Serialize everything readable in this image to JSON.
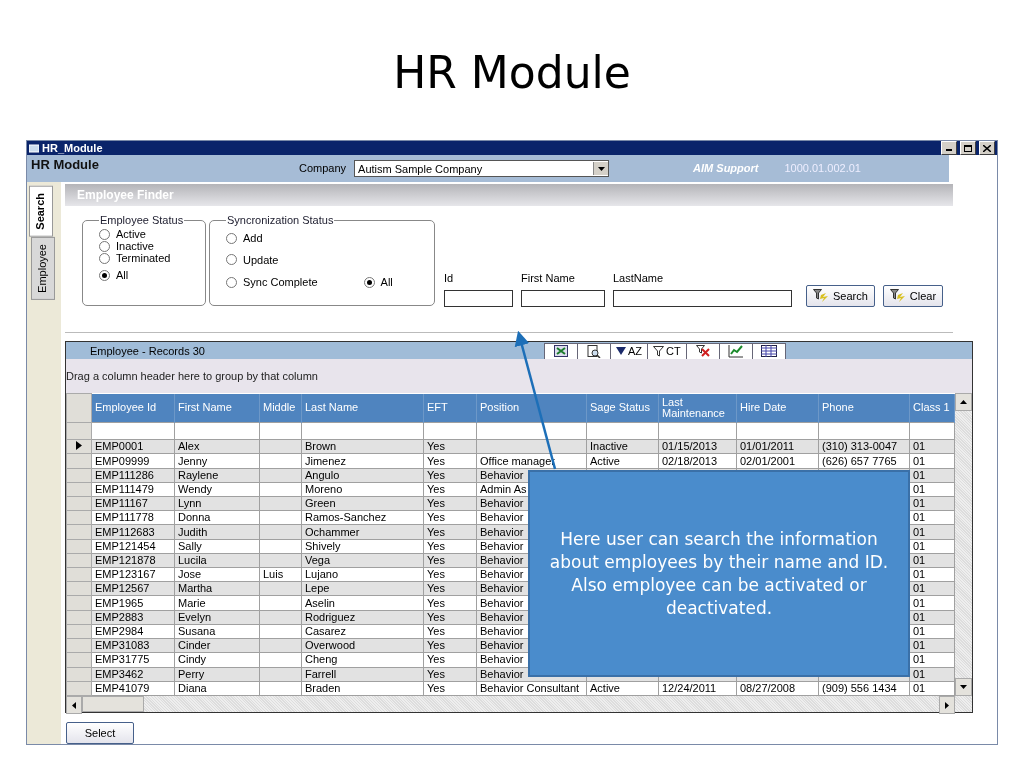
{
  "slide_title": "HR Module",
  "window": {
    "title": "HR_Module",
    "header": "HR Module",
    "company_label": "Company",
    "company_value": "Autism Sample Company",
    "brand": "AIM Support",
    "version": "1000.01.002.01"
  },
  "side_tabs": [
    {
      "label": "Search",
      "selected": true
    },
    {
      "label": "Employee",
      "selected": false
    }
  ],
  "finder": {
    "title": "Employee Finder",
    "employee_status": {
      "legend": "Employee Status",
      "options": [
        {
          "label": "Active",
          "selected": false
        },
        {
          "label": "Inactive",
          "selected": false
        },
        {
          "label": "Terminated",
          "selected": false
        },
        {
          "label": "All",
          "selected": true
        }
      ]
    },
    "sync_status": {
      "legend": "Syncronization Status",
      "options": [
        {
          "label": "Add",
          "selected": false
        },
        {
          "label": "Update",
          "selected": false
        },
        {
          "label": "Sync Complete",
          "selected": false
        },
        {
          "label": "All",
          "selected": true
        }
      ]
    },
    "fields": [
      {
        "label": "Id"
      },
      {
        "label": "First Name"
      },
      {
        "label": "LastName"
      }
    ],
    "buttons": [
      "Search",
      "Clear"
    ]
  },
  "grid": {
    "title": "Employee - Records 30",
    "group_hint": "Drag a column header here to group by that column",
    "toolbar": [
      {
        "kind": "export"
      },
      {
        "kind": "preview"
      },
      {
        "kind": "sort",
        "label": "AZ"
      },
      {
        "kind": "filter",
        "label": "CT"
      },
      {
        "kind": "clear"
      },
      {
        "kind": "chart"
      },
      {
        "kind": "columns"
      }
    ],
    "columns": [
      "Employee Id",
      "First Name",
      "Middle",
      "Last Name",
      "EFT",
      "Position",
      "Sage Status",
      "Last Maintenance",
      "Hire Date",
      "Phone",
      "Class 1"
    ],
    "rows": [
      {
        "selected": true,
        "cells": [
          "EMP0001",
          "Alex",
          null,
          "Brown",
          "Yes",
          null,
          "Inactive",
          "01/15/2013",
          "01/01/2011",
          "(310) 313-0047",
          "01"
        ]
      },
      {
        "selected": false,
        "cells": [
          "EMP09999",
          "Jenny",
          null,
          "Jimenez",
          "Yes",
          "Office manager",
          "Active",
          "02/18/2013",
          "02/01/2001",
          "(626) 657 7765",
          "01"
        ]
      },
      {
        "selected": false,
        "cells": [
          "EMP111286",
          "Raylene",
          null,
          "Angulo",
          "Yes",
          "Behavior",
          null,
          null,
          null,
          null,
          "01"
        ]
      },
      {
        "selected": false,
        "cells": [
          "EMP111479",
          "Wendy",
          null,
          "Moreno",
          "Yes",
          "Admin As",
          null,
          null,
          null,
          null,
          "01"
        ]
      },
      {
        "selected": false,
        "cells": [
          "EMP11167",
          "Lynn",
          null,
          "Green",
          "Yes",
          "Behavior",
          null,
          null,
          null,
          null,
          "01"
        ]
      },
      {
        "selected": false,
        "cells": [
          "EMP111778",
          "Donna",
          null,
          "Ramos-Sanchez",
          "Yes",
          "Behavior",
          null,
          null,
          null,
          null,
          "01"
        ]
      },
      {
        "selected": false,
        "cells": [
          "EMP112683",
          "Judith",
          null,
          "Ochammer",
          "Yes",
          "Behavior",
          null,
          null,
          null,
          null,
          "01"
        ]
      },
      {
        "selected": false,
        "cells": [
          "EMP121454",
          "Sally",
          null,
          "Shively",
          "Yes",
          "Behavior",
          null,
          null,
          null,
          null,
          "01"
        ]
      },
      {
        "selected": false,
        "cells": [
          "EMP121878",
          "Lucila",
          null,
          "Vega",
          "Yes",
          "Behavior",
          null,
          null,
          null,
          null,
          "01"
        ]
      },
      {
        "selected": false,
        "cells": [
          "EMP123167",
          "Jose",
          "Luis",
          "Lujano",
          "Yes",
          "Behavior",
          null,
          null,
          null,
          null,
          "01"
        ]
      },
      {
        "selected": false,
        "cells": [
          "EMP12567",
          "Martha",
          null,
          "Lepe",
          "Yes",
          "Behavior",
          null,
          null,
          null,
          null,
          "01"
        ]
      },
      {
        "selected": false,
        "cells": [
          "EMP1965",
          "Marie",
          null,
          "Aselin",
          "Yes",
          "Behavior",
          null,
          null,
          null,
          null,
          "01"
        ]
      },
      {
        "selected": false,
        "cells": [
          "EMP2883",
          "Evelyn",
          null,
          "Rodriguez",
          "Yes",
          "Behavior",
          null,
          null,
          null,
          null,
          "01"
        ]
      },
      {
        "selected": false,
        "cells": [
          "EMP2984",
          "Susana",
          null,
          "Casarez",
          "Yes",
          "Behavior",
          null,
          null,
          null,
          null,
          "01"
        ]
      },
      {
        "selected": false,
        "cells": [
          "EMP31083",
          "Cinder",
          null,
          "Overwood",
          "Yes",
          "Behavior",
          null,
          null,
          null,
          null,
          "01"
        ]
      },
      {
        "selected": false,
        "cells": [
          "EMP31775",
          "Cindy",
          null,
          "Cheng",
          "Yes",
          "Behavior",
          null,
          null,
          null,
          null,
          "01"
        ]
      },
      {
        "selected": false,
        "cells": [
          "EMP3462",
          "Perry",
          null,
          "Farrell",
          "Yes",
          "Behavior",
          null,
          null,
          null,
          null,
          "01"
        ]
      },
      {
        "selected": false,
        "cells": [
          "EMP41079",
          "Diana",
          null,
          "Braden",
          "Yes",
          "Behavior Consultant",
          "Active",
          "12/24/2011",
          "08/27/2008",
          "(909) 556 1434",
          "01"
        ]
      }
    ]
  },
  "select_button": "Select",
  "callout": "Here user can search the information about employees by their name and ID. Also employee can be activated or deactivated."
}
